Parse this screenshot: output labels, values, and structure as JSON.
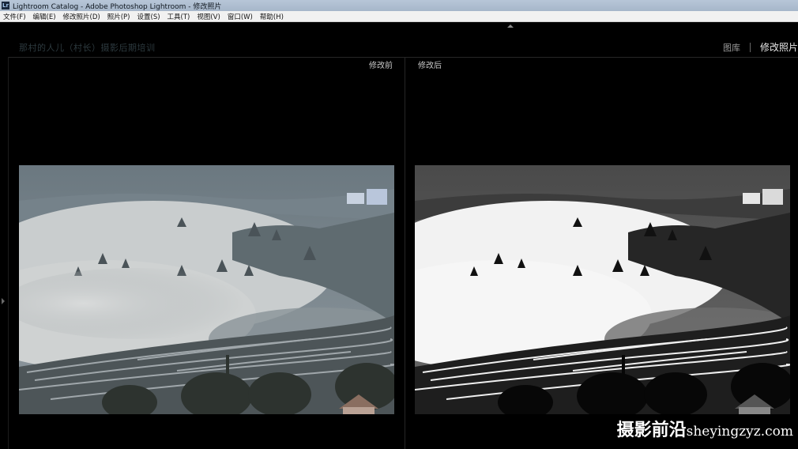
{
  "window": {
    "icon_text": "Lr",
    "title": "Lightroom Catalog - Adobe Photoshop Lightroom - 修改照片"
  },
  "menu": [
    {
      "label": "文件(F)"
    },
    {
      "label": "编辑(E)"
    },
    {
      "label": "修改照片(D)"
    },
    {
      "label": "照片(P)"
    },
    {
      "label": "设置(S)"
    },
    {
      "label": "工具(T)"
    },
    {
      "label": "视图(V)"
    },
    {
      "label": "窗口(W)"
    },
    {
      "label": "帮助(H)"
    }
  ],
  "identity_plate": "那村的人儿（村长）摄影后期培训",
  "module_picker": {
    "library": "图库",
    "develop": "修改照片"
  },
  "compare": {
    "before_label": "修改前",
    "after_label": "修改后",
    "before_style": "color",
    "after_style": "black-and-white"
  },
  "watermark": {
    "text_cn": "摄影前沿",
    "text_url": "sheyingzyz.com"
  },
  "colors": {
    "titlebar": "#aebed2",
    "menubar": "#f1f1f1",
    "workspace": "#000000",
    "active_module": "#e6e6e6",
    "inactive_module": "#9a9a9a"
  }
}
